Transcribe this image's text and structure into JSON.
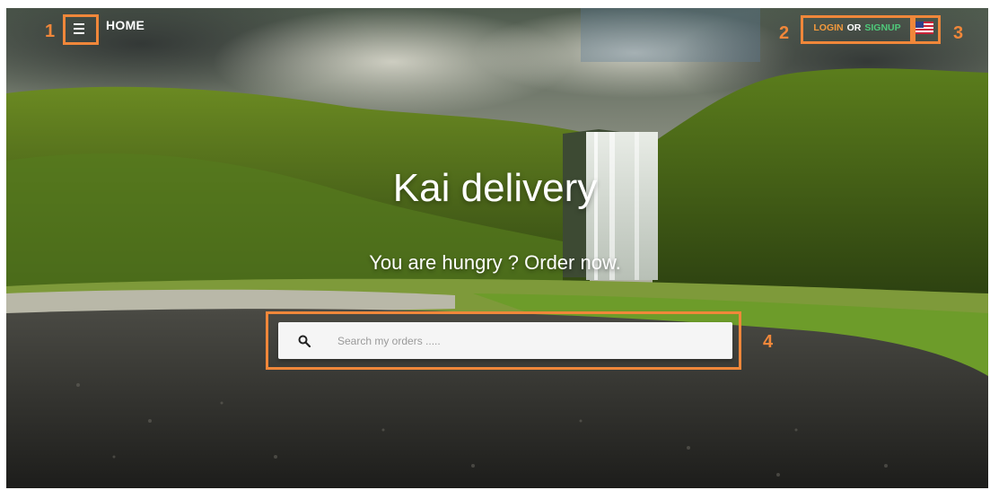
{
  "nav": {
    "home_label": "HOME",
    "menu_icon": "hamburger-menu-icon",
    "login_label": "LOGIN",
    "or_label": "OR",
    "signup_label": "SIGNUP",
    "language_flag": "us-flag-icon"
  },
  "hero": {
    "title": "Kai delivery",
    "subtitle": "You are hungry ? Order now."
  },
  "search": {
    "placeholder": "Search my orders .....",
    "icon": "search-icon"
  },
  "annotations": {
    "labels": [
      "1",
      "2",
      "3",
      "4"
    ],
    "color": "#f0873a"
  },
  "colors": {
    "login": "#f39a3d",
    "signup": "#4fc97a"
  }
}
